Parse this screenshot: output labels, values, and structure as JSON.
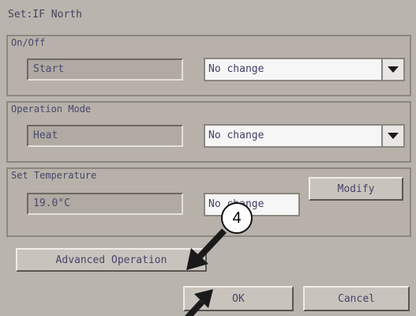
{
  "window": {
    "title": "Set:IF North"
  },
  "on_off": {
    "label": "On/Off",
    "current_value": "Start",
    "selected_option": "No change"
  },
  "operation_mode": {
    "label": "Operation Mode",
    "current_value": "Heat",
    "selected_option": "No change"
  },
  "set_temperature": {
    "label": "Set Temperature",
    "current_value": "19.0°C",
    "selected_option": "No change",
    "modify_label": "Modify"
  },
  "buttons": {
    "advanced_operation": "Advanced Operation",
    "ok": "OK",
    "cancel": "Cancel"
  },
  "annotation": {
    "step_number": "4"
  }
}
